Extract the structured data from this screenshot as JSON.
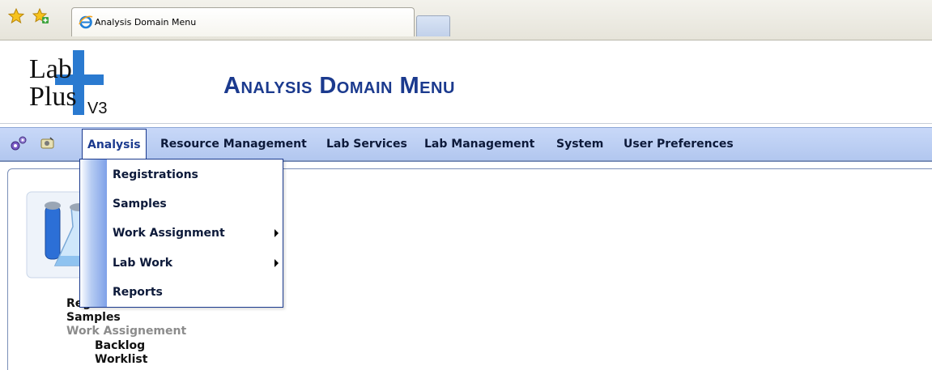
{
  "browser": {
    "tab_title": "Analysis Domain Menu"
  },
  "header": {
    "title": "Analysis Domain Menu",
    "logo_text": [
      "Lab",
      "Plus",
      "V3"
    ]
  },
  "menubar": {
    "items": [
      "Analysis",
      "Resource Management",
      "Lab Services",
      "Lab Management",
      "System",
      "User Preferences"
    ],
    "active": "Analysis"
  },
  "dropdown": {
    "items": [
      {
        "label": "Registrations",
        "has_submenu": false
      },
      {
        "label": "Samples",
        "has_submenu": false
      },
      {
        "label": "Work Assignment",
        "has_submenu": true
      },
      {
        "label": "Lab Work",
        "has_submenu": true
      },
      {
        "label": "Reports",
        "has_submenu": false
      }
    ]
  },
  "tree": {
    "items": [
      "Registrations",
      "Samples",
      "Work Assignement"
    ],
    "subitems": [
      "Backlog",
      "Worklist"
    ]
  },
  "colors": {
    "accent": "#1b3a8e",
    "menubar": "#b2c7ef",
    "disabled": "#8c8c8c"
  }
}
